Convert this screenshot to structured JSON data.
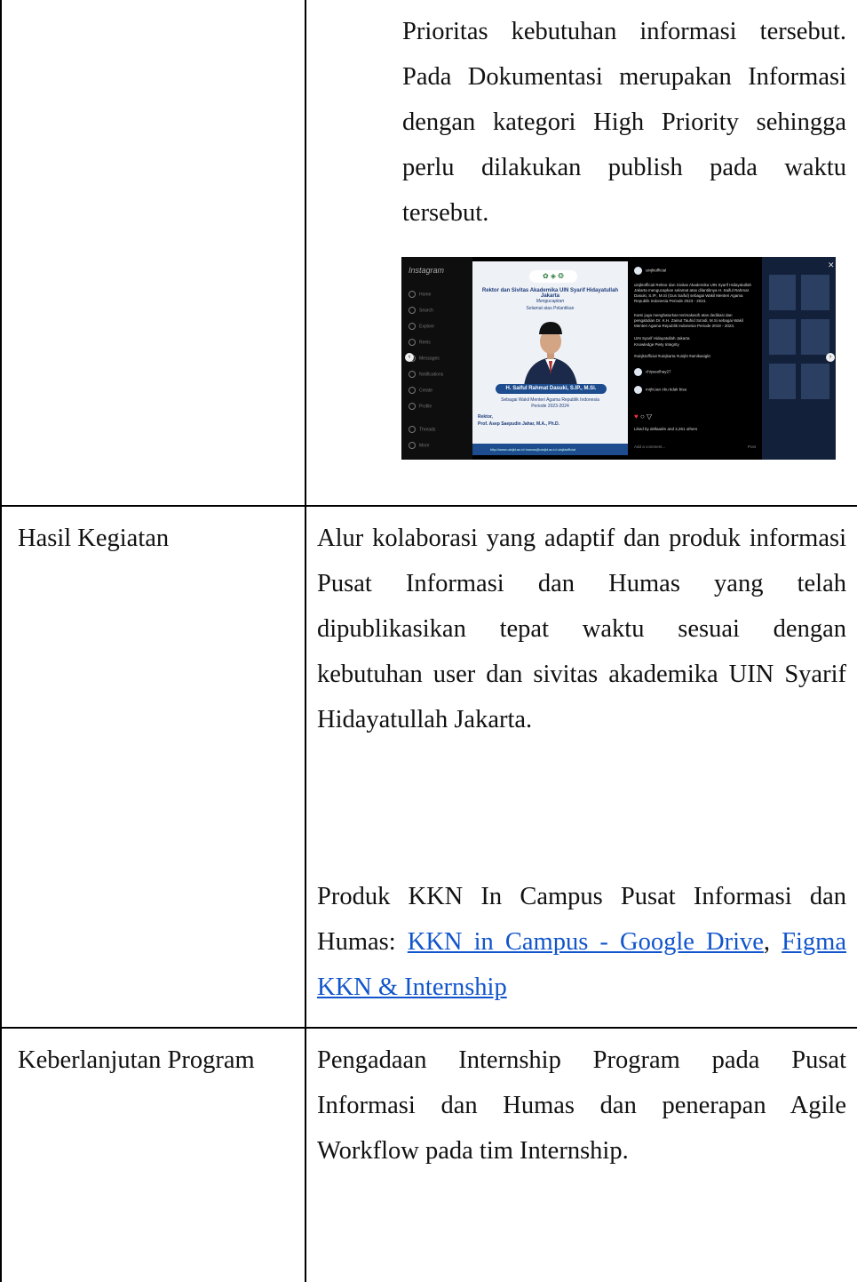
{
  "rows": [
    {
      "label": "",
      "content": "Prioritas kebutuhan informasi tersebut. Pada Dokumentasi merupakan Informasi dengan kategori High Priority sehingga perlu dilakukan publish pada waktu tersebut."
    },
    {
      "label": "Hasil Kegiatan",
      "content": "Alur kolaborasi yang adaptif dan produk informasi Pusat Informasi dan Humas yang telah dipublikasikan tepat waktu sesuai dengan kebutuhan user dan sivitas akademika UIN Syarif Hidayatullah Jakarta.",
      "products_prefix": "Produk KKN In Campus Pusat Informasi dan Humas: ",
      "link1": "KKN in Campus - Google Drive",
      "separator": ",",
      "link2": "Figma KKN & Internship"
    },
    {
      "label": "Keberlanjutan Program",
      "content": "Pengadaan Internship Program pada Pusat Informasi dan Humas dan penerapan Agile Workflow pada tim Internship."
    }
  ],
  "screenshot": {
    "logo": "Instagram",
    "nav": [
      "Home",
      "Search",
      "Explore",
      "Reels",
      "Messages",
      "Notifications",
      "Create",
      "Profile",
      "Threads",
      "More"
    ],
    "post_logos": "✿ ◈ ❂",
    "post_line1": "Rektor dan Sivitas Akademika UIN Syarif Hidayatullah Jakarta",
    "post_line2": "Mengucapkan",
    "post_line3": "Selamat atas Pelantikan",
    "post_name": "H. Saiful Rahmat Dasuki, S.IP., M.Si.",
    "post_role": "Sebagai Wakil Menteri Agama Republik Indonesia",
    "post_period": "Periode 2023-2024",
    "post_rektor": "Rektor,",
    "post_rektor_name": "Prof. Asep Saepudin Jahar, M.A., Ph.D.",
    "post_footer": "http://www.uinjkt.ac.id    humas@uinjkt.ac.id    uinjktofficial",
    "account": "uinjktofficial",
    "caption": "uinjktofficial Rektor dan Sivitas Akademika UIN Syarif Hidayatullah Jakarta mengucapkan selamat atas dilantiknya H. Saiful Rahmat Dasuki, S.IP., M.Si (Gus Saiful) sebagai Wakil Menteri Agama Republik Indonesia Periode 2023 - 2024.",
    "caption2": "Kami juga menghaturkan terimakasih atas dedikasi dan pengabdian Dr. K.H. Zainut Tauhid Sa'adi, M.Si sebagai Wakil Menteri Agama Republik Indonesia Periode 2019 - 2023.",
    "caption3": "UIN Syarif Hidayatullah Jakarta",
    "caption4": "Knowledge Piety Integrity",
    "hashtags": "#uinjktofficial #uinjkarta #uinjkt #amikasigkt",
    "comment1_user": "chiyasolhay27",
    "comment2_user": "mrjkt.ian",
    "comment2_text": "Aku tidak bisa",
    "liked_by": "Liked by dellaadm and 2,261 others",
    "add_comment": "Add a comment...",
    "post_btn": "Post"
  }
}
